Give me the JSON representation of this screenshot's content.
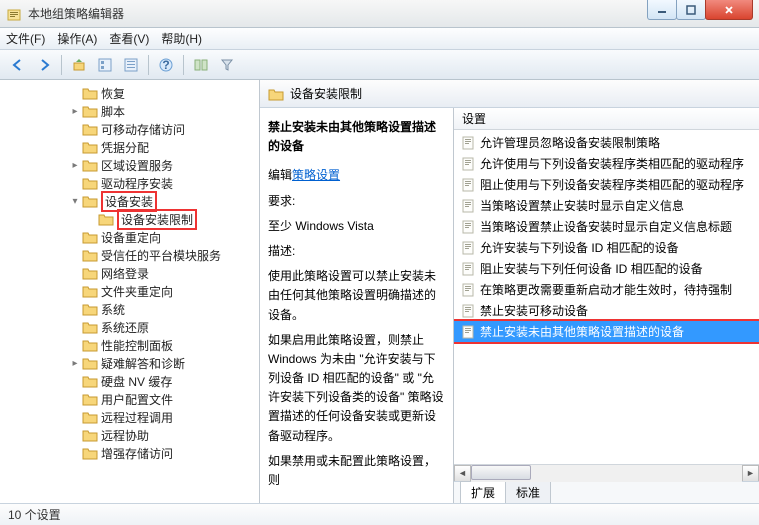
{
  "window": {
    "title": "本地组策略编辑器"
  },
  "menubar": [
    "文件(F)",
    "操作(A)",
    "查看(V)",
    "帮助(H)"
  ],
  "tree": {
    "items": [
      "恢复",
      "脚本",
      "可移动存储访问",
      "凭据分配",
      "区域设置服务",
      "驱动程序安装",
      "设备安装",
      "设备安装限制",
      "设备重定向",
      "受信任的平台模块服务",
      "网络登录",
      "文件夹重定向",
      "系统",
      "系统还原",
      "性能控制面板",
      "疑难解答和诊断",
      "硬盘 NV 缓存",
      "用户配置文件",
      "远程过程调用",
      "远程协助",
      "增强存储访问"
    ]
  },
  "right": {
    "header": "设备安装限制",
    "desc": {
      "title": "禁止安装未由其他策略设置描述的设备",
      "edit_prefix": "编辑",
      "edit_link": "策略设置",
      "req_label": "要求:",
      "req_value": "至少 Windows Vista",
      "desc_label": "描述:",
      "desc_text": "使用此策略设置可以禁止安装未由任何其他策略设置明确描述的设备。",
      "desc_more": "如果启用此策略设置，则禁止 Windows 为未由 \"允许安装与下列设备 ID 相匹配的设备\" 或 \"允许安装下列设备类的设备\" 策略设置描述的任何设备安装或更新设备驱动程序。",
      "desc_tail": "如果禁用或未配置此策略设置，则"
    },
    "list": {
      "header": "设置",
      "items": [
        "允许管理员忽略设备安装限制策略",
        "允许使用与下列设备安装程序类相匹配的驱动程序",
        "阻止使用与下列设备安装程序类相匹配的驱动程序",
        "当策略设置禁止安装时显示自定义信息",
        "当策略设置禁止设备安装时显示自定义信息标题",
        "允许安装与下列设备 ID 相匹配的设备",
        "阻止安装与下列任何设备 ID 相匹配的设备",
        "在策略更改需要重新启动才能生效时，待持强制",
        "禁止安装可移动设备",
        "禁止安装未由其他策略设置描述的设备"
      ],
      "selected_index": 9
    },
    "tabs": [
      "扩展",
      "标准"
    ]
  },
  "statusbar": "10 个设置"
}
